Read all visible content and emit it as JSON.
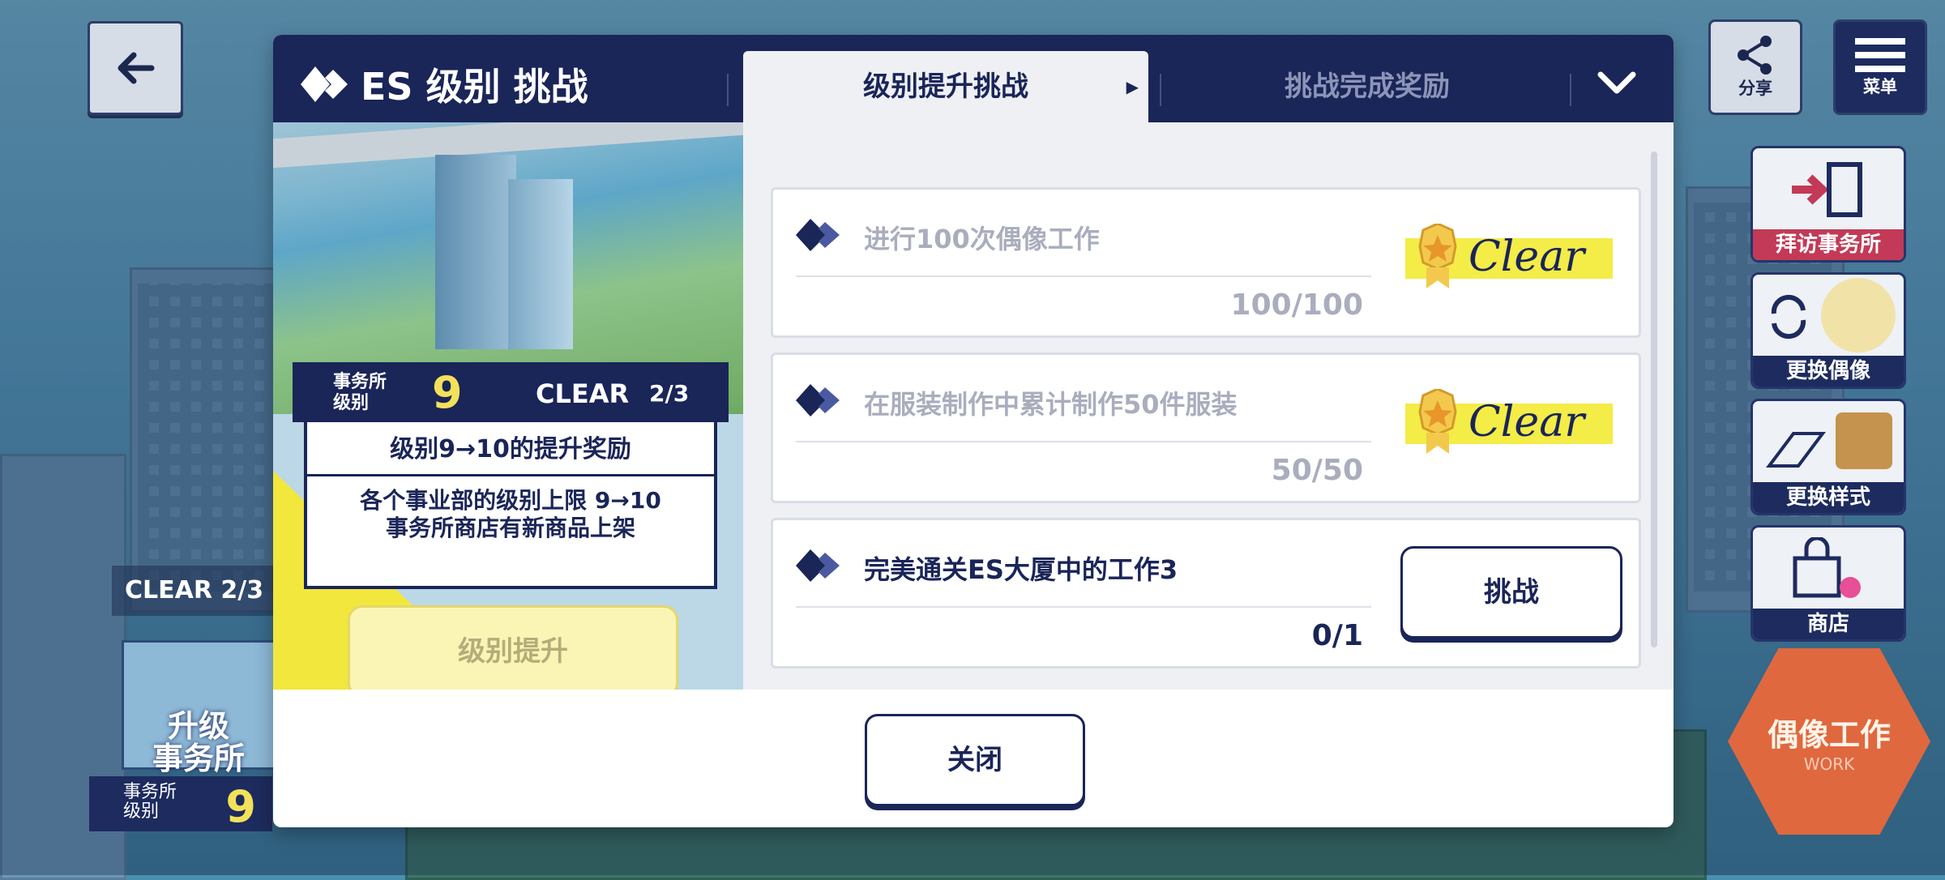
{
  "hud": {
    "share_label": "分享",
    "menu_label": "菜单",
    "side_buttons": [
      {
        "label": "拜访事务所"
      },
      {
        "label": "更换偶像"
      },
      {
        "label": "更换样式"
      },
      {
        "label": "商店"
      }
    ],
    "work_label": "偶像工作",
    "work_sub": "WORK",
    "clear_status": "CLEAR  2/3",
    "upgrade_label_1": "升级",
    "upgrade_label_2": "事务所",
    "office_level_label_1": "事务所",
    "office_level_label_2": "级别",
    "office_level": "9"
  },
  "modal": {
    "title": "ES 级别 挑战",
    "tabs": {
      "active": "级别提升挑战",
      "other": "挑战完成奖励"
    },
    "level_card": {
      "label_1": "事务所",
      "label_2": "级别",
      "level": "9",
      "clear_label": "CLEAR",
      "clear_count": "2/3",
      "reward_title": "级别9→10的提升奖励",
      "desc_1": "各个事业部的级别上限 9→10",
      "desc_2": "事务所商店有新商品上架"
    },
    "level_up_button": "级别提升",
    "challenges": [
      {
        "text": "进行100次偶像工作",
        "progress": "100/100",
        "status": "Clear"
      },
      {
        "text": "在服装制作中累计制作50件服装",
        "progress": "50/50",
        "status": "Clear"
      },
      {
        "text": "完美通关ES大厦中的工作3",
        "progress": "0/1",
        "button": "挑战"
      }
    ],
    "close_button": "关闭"
  },
  "colors": {
    "navy": "#1a2558",
    "yellow": "#f3e15a",
    "clear_yellow": "#f4ec47",
    "work_orange": "#e0683e"
  }
}
